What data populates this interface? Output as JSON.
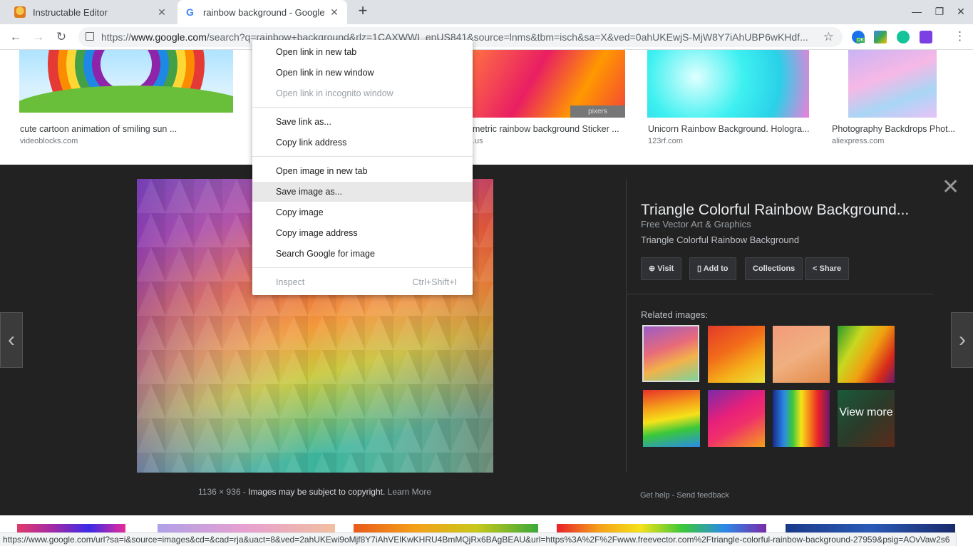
{
  "browser": {
    "tabs": [
      {
        "title": "Instructable Editor",
        "icon": "instructables-favicon"
      },
      {
        "title": "rainbow background - Google Search",
        "icon": "google-favicon",
        "active": true
      }
    ],
    "url_prefix": "https://",
    "url_domain": "www.google.com",
    "url_rest": "/search?q=rainbow+background&rlz=1CAXWWI_enUS841&source=lnms&tbm=isch&sa=X&ved=0ahUKEwjS-MjW8Y7iAhUBP6wKHdf...",
    "extension_badge": "OK"
  },
  "results_row": [
    {
      "caption": "cute cartoon animation of smiling sun ...",
      "source": "videoblocks.com"
    },
    {
      "caption": "metric rainbow background Sticker ...",
      "source": ".us",
      "watermark": "pixers"
    },
    {
      "caption": "Unicorn Rainbow Background. Hologra...",
      "source": "123rf.com"
    },
    {
      "caption": "Photography Backdrops Phot...",
      "source": "aliexpress.com"
    }
  ],
  "viewer": {
    "dimensions": "1136 × 936",
    "separator": "-",
    "copyright": "Images may be subject to copyright.",
    "learn_more": "Learn More",
    "title": "Triangle Colorful Rainbow Background...",
    "subtitle": "Free Vector Art & Graphics",
    "description": "Triangle Colorful Rainbow Background",
    "buttons": {
      "visit": "Visit",
      "add_to": "Add to",
      "collections": "Collections",
      "share": "Share"
    },
    "related_label": "Related images:",
    "view_more": "View more",
    "get_help": "Get help",
    "feedback_sep": "-",
    "send_feedback": "Send feedback"
  },
  "context_menu": {
    "items": [
      "Open link in new tab",
      "Open link in new window",
      "Open link in incognito window",
      "Save link as...",
      "Copy link address",
      "Open image in new tab",
      "Save image as...",
      "Copy image",
      "Copy image address",
      "Search Google for image",
      "Inspect"
    ],
    "inspect_shortcut": "Ctrl+Shift+I"
  },
  "status_url": "https://www.google.com/url?sa=i&source=images&cd=&cad=rja&uact=8&ved=2ahUKEwi9oMjf8Y7iAhVElKwKHRU4BmMQjRx6BAgBEAU&url=https%3A%2F%2Fwww.freevector.com%2Ftriangle-colorful-rainbow-background-27959&psig=AOvVaw2s6"
}
